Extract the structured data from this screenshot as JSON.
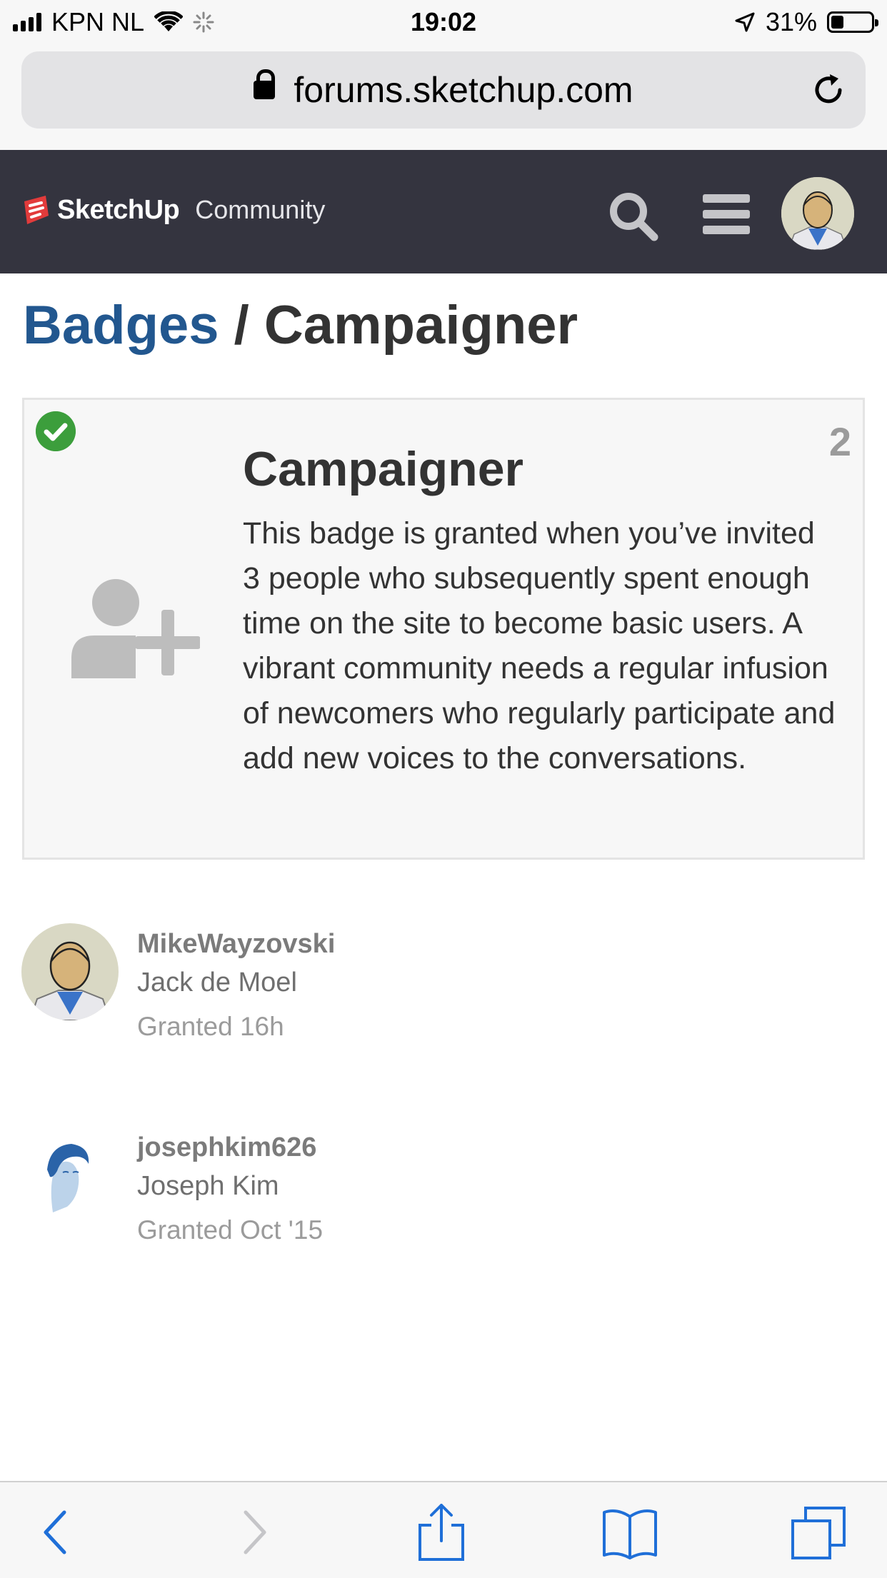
{
  "status_bar": {
    "carrier": "KPN NL",
    "time": "19:02",
    "battery_percent": "31%",
    "battery_level": 0.31
  },
  "browser": {
    "url": "forums.sketchup.com"
  },
  "site_header": {
    "logo_text": "SketchUp",
    "logo_subtitle": "Community",
    "icons": [
      "search-icon",
      "hamburger-menu-icon",
      "user-avatar"
    ]
  },
  "breadcrumb": {
    "parent": "Badges",
    "separator": " / ",
    "current": "Campaigner"
  },
  "badge": {
    "name": "Campaigner",
    "granted_count": "2",
    "icon": "user-plus-icon",
    "status_icon": "check-circle-icon",
    "description": "This badge is granted when you’ve invited 3 people who subsequently spent enough time on the site to become basic users. A vibrant community needs a regular infusion of newcomers who regularly participate and add new voices to the conversations."
  },
  "grantees": [
    {
      "username": "MikeWayzovski",
      "full_name": "Jack de Moel",
      "granted": "Granted 16h"
    },
    {
      "username": "josephkim626",
      "full_name": "Joseph Kim",
      "granted": "Granted Oct '15"
    }
  ],
  "toolbar": {
    "icons": [
      "back-icon",
      "forward-icon",
      "share-icon",
      "bookmarks-icon",
      "tabs-icon"
    ]
  },
  "colors": {
    "header_bg": "#34343f",
    "link_blue": "#22578f",
    "granted_green": "#3c9e3c",
    "ios_blue": "#1f6fd8"
  }
}
